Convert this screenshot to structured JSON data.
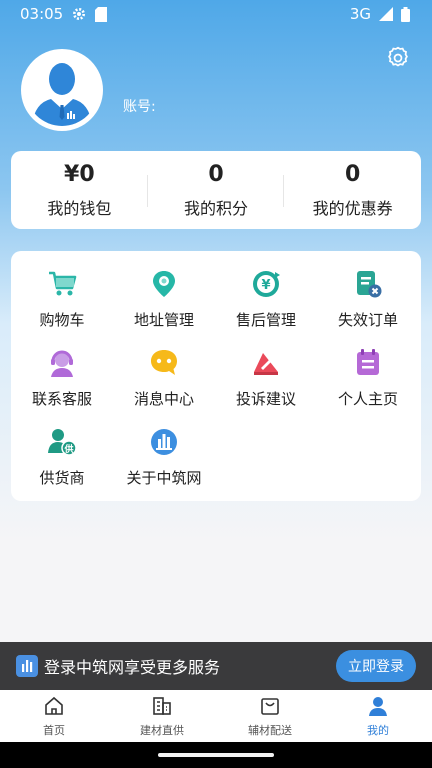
{
  "status_bar": {
    "time": "03:05",
    "network": "3G",
    "icons": [
      "settings-gear-icon",
      "sim-card-icon",
      "signal-icon",
      "battery-icon"
    ]
  },
  "header": {
    "settings_icon": "gear-icon",
    "account_label": "账号:"
  },
  "stats": [
    {
      "value": "¥0",
      "label": "我的钱包"
    },
    {
      "value": "0",
      "label": "我的积分"
    },
    {
      "value": "0",
      "label": "我的优惠券"
    }
  ],
  "menu": [
    {
      "label": "购物车",
      "icon": "cart-icon",
      "color": "#2bb6a8"
    },
    {
      "label": "地址管理",
      "icon": "location-pin-icon",
      "color": "#26b7a7"
    },
    {
      "label": "售后管理",
      "icon": "yen-refund-icon",
      "color": "#1fa99a"
    },
    {
      "label": "失效订单",
      "icon": "invalid-order-icon",
      "color": "#2aa594"
    },
    {
      "label": "联系客服",
      "icon": "customer-service-icon",
      "color": "#b06ad8"
    },
    {
      "label": "消息中心",
      "icon": "message-icon",
      "color": "#f6b91a"
    },
    {
      "label": "投诉建议",
      "icon": "complaint-icon",
      "color": "#ea4a5a"
    },
    {
      "label": "个人主页",
      "icon": "profile-page-icon",
      "color": "#b569d6"
    },
    {
      "label": "供货商",
      "icon": "supplier-icon",
      "color": "#1f9a84"
    },
    {
      "label": "关于中筑网",
      "icon": "about-logo-icon",
      "color": "#3d8fe0"
    }
  ],
  "banner": {
    "text": "登录中筑网享受更多服务",
    "button": "立即登录"
  },
  "tabs": [
    {
      "label": "首页",
      "icon": "home-icon",
      "active": false
    },
    {
      "label": "建材直供",
      "icon": "building-icon",
      "active": false
    },
    {
      "label": "辅材配送",
      "icon": "shopping-bag-icon",
      "active": false
    },
    {
      "label": "我的",
      "icon": "user-icon",
      "active": true
    }
  ],
  "colors": {
    "primary": "#2f7fd8",
    "header_gradient_top": "#4fa8e8",
    "banner_bg": "#3a3a3c"
  }
}
